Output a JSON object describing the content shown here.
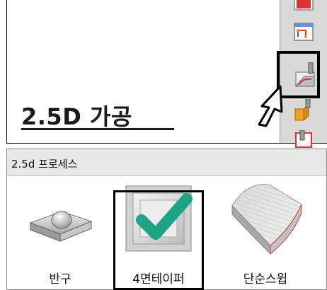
{
  "heading": {
    "text": "2.5D 가공"
  },
  "toolbar": {
    "tools": [
      {
        "icon": "tool-red-icon"
      },
      {
        "icon": "tool-path-icon"
      },
      {
        "icon": "tool-2-5d-machining-icon",
        "selected": true
      },
      {
        "icon": "tool-pocket-icon"
      },
      {
        "icon": "tool-profile-icon"
      }
    ]
  },
  "process_panel": {
    "title": "2.5d 프로세스",
    "items": [
      {
        "label": "반구",
        "icon": "hemisphere-icon",
        "selected": false
      },
      {
        "label": "4면테이퍼",
        "icon": "checkmark-icon",
        "selected": true
      },
      {
        "label": "단순스윕",
        "icon": "simple-sweep-icon",
        "selected": false
      }
    ]
  },
  "colors": {
    "check": "#1fa385",
    "toolbar_bg": "#d9d9d9",
    "header_bg": "#e8e8e8",
    "highlight_frame": "#000000"
  }
}
